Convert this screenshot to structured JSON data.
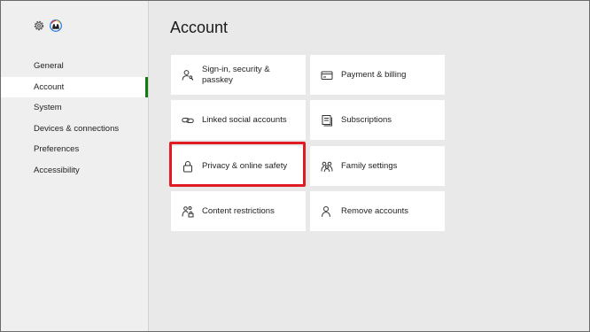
{
  "sidebar": {
    "items": [
      {
        "label": "General"
      },
      {
        "label": "Account",
        "active": true
      },
      {
        "label": "System"
      },
      {
        "label": "Devices & connections"
      },
      {
        "label": "Preferences"
      },
      {
        "label": "Accessibility"
      }
    ],
    "icons": [
      "gear-icon",
      "avatar-icon"
    ]
  },
  "main": {
    "title": "Account",
    "tiles": [
      {
        "label": "Sign-in, security & passkey",
        "icon": "person-key-icon"
      },
      {
        "label": "Payment & billing",
        "icon": "card-icon"
      },
      {
        "label": "Linked social accounts",
        "icon": "link-icon"
      },
      {
        "label": "Subscriptions",
        "icon": "subscriptions-icon"
      },
      {
        "label": "Privacy & online safety",
        "icon": "lock-icon"
      },
      {
        "label": "Family settings",
        "icon": "family-icon"
      },
      {
        "label": "Content restrictions",
        "icon": "people-lock-icon"
      },
      {
        "label": "Remove accounts",
        "icon": "person-remove-icon"
      }
    ]
  },
  "colors": {
    "accent": "#107c10",
    "highlight": "#e01b24"
  }
}
